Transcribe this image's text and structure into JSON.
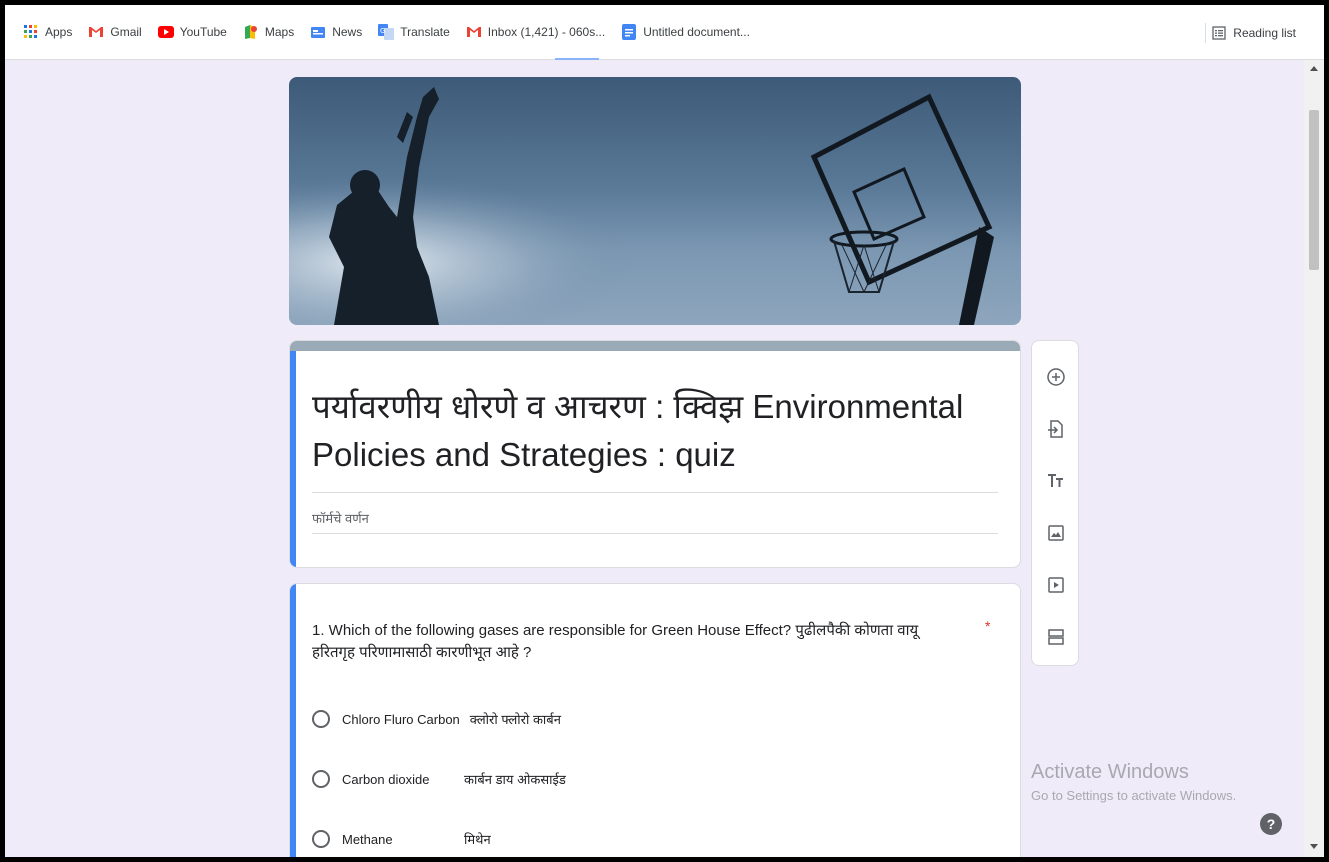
{
  "bookmarks": [
    {
      "label": "Apps",
      "icon": "apps-grid-icon"
    },
    {
      "label": "Gmail",
      "icon": "gmail-icon"
    },
    {
      "label": "YouTube",
      "icon": "youtube-icon"
    },
    {
      "label": "Maps",
      "icon": "maps-icon"
    },
    {
      "label": "News",
      "icon": "news-icon"
    },
    {
      "label": "Translate",
      "icon": "translate-icon"
    },
    {
      "label": "Inbox (1,421) - 060s...",
      "icon": "gmail-icon"
    },
    {
      "label": "Untitled document...",
      "icon": "docs-icon"
    }
  ],
  "reading_list": "Reading list",
  "form": {
    "title": "पर्यावरणीय धोरणे व आचरण : क्विझ Environmental Policies and Strategies : quiz",
    "description": "फॉर्मचे वर्णन"
  },
  "question": {
    "text": "1. Which of the following gases are responsible for Green House Effect? पुढीलपैकी कोणता वायू हरितगृह परिणामासाठी कारणीभूत आहे ?",
    "required_mark": "*",
    "options": [
      {
        "label": "Chloro Fluro Carbon",
        "label_mr": "क्लोरो फ्लोरो कार्बन"
      },
      {
        "label": "Carbon dioxide",
        "label_mr": "कार्बन डाय ओकसाईड"
      },
      {
        "label": "Methane",
        "label_mr": "मिथेन"
      }
    ]
  },
  "toolbar": [
    "add-question-icon",
    "import-questions-icon",
    "add-title-icon",
    "add-image-icon",
    "add-video-icon",
    "add-section-icon"
  ],
  "watermark": {
    "title": "Activate Windows",
    "subtitle": "Go to Settings to activate Windows."
  },
  "help": "?",
  "colors": {
    "accent": "#4285f4",
    "page_bg": "#f0ebf8",
    "required": "#d93025"
  }
}
